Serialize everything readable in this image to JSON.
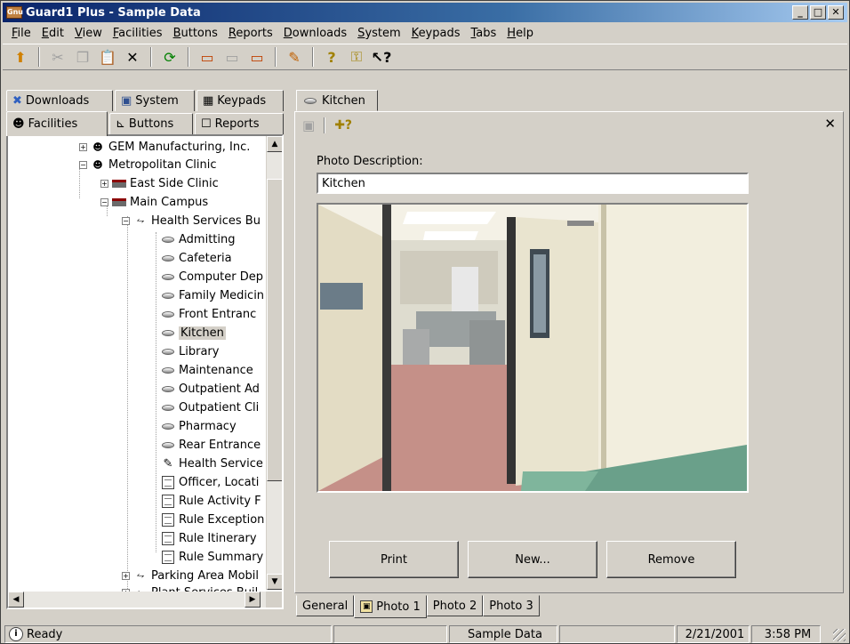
{
  "window": {
    "title": "Guard1 Plus - Sample Data",
    "app_icon_text": "Gnu",
    "minimize": "_",
    "maximize": "□",
    "close": "✕"
  },
  "menu": [
    "File",
    "Edit",
    "View",
    "Facilities",
    "Buttons",
    "Reports",
    "Downloads",
    "System",
    "Keypads",
    "Tabs",
    "Help"
  ],
  "toolbar_icons": [
    "up-folder-icon",
    "cut-icon",
    "copy-icon",
    "paste-icon",
    "delete-icon",
    "refresh-icon",
    "card-icon",
    "card-blank-icon",
    "card-red-icon",
    "paint-icon",
    "help-icon",
    "key-help-icon",
    "whats-this-icon"
  ],
  "left_tabs": {
    "downloads": "Downloads",
    "system": "System",
    "keypads": "Keypads",
    "facilities": "Facilities",
    "buttons": "Buttons",
    "reports": "Reports"
  },
  "tree": [
    {
      "label": "GEM Manufacturing, Inc.",
      "icon": "person-icon"
    },
    {
      "label": "Metropolitan Clinic",
      "icon": "person-icon"
    },
    {
      "label": "East Side Clinic",
      "icon": "building-icon"
    },
    {
      "label": "Main Campus",
      "icon": "building-icon"
    },
    {
      "label": "Health Services Bu",
      "icon": "route-icon"
    },
    {
      "label": "Admitting",
      "icon": "checkpoint-icon"
    },
    {
      "label": "Cafeteria",
      "icon": "checkpoint-icon"
    },
    {
      "label": "Computer Dep",
      "icon": "checkpoint-icon"
    },
    {
      "label": "Family Medicin",
      "icon": "checkpoint-icon"
    },
    {
      "label": "Front Entranc",
      "icon": "checkpoint-icon"
    },
    {
      "label": "Kitchen",
      "icon": "checkpoint-icon"
    },
    {
      "label": "Library",
      "icon": "checkpoint-icon"
    },
    {
      "label": "Maintenance",
      "icon": "checkpoint-icon"
    },
    {
      "label": "Outpatient Ad",
      "icon": "checkpoint-icon"
    },
    {
      "label": "Outpatient Cli",
      "icon": "checkpoint-icon"
    },
    {
      "label": "Pharmacy",
      "icon": "checkpoint-icon"
    },
    {
      "label": "Rear Entrance",
      "icon": "checkpoint-icon"
    },
    {
      "label": "Health Service",
      "icon": "itinerary-icon"
    },
    {
      "label": "Officer, Locati",
      "icon": "report-icon"
    },
    {
      "label": "Rule Activity F",
      "icon": "report-icon"
    },
    {
      "label": "Rule Exception",
      "icon": "report-icon"
    },
    {
      "label": "Rule Itinerary",
      "icon": "report-icon"
    },
    {
      "label": "Rule Summary",
      "icon": "report-icon"
    },
    {
      "label": "Parking Area Mobil",
      "icon": "route-icon"
    },
    {
      "label": "Plant Services Buil",
      "icon": "route-icon"
    }
  ],
  "doc_tab": "Kitchen",
  "photo": {
    "label": "Photo Description:",
    "value": "Kitchen",
    "print": "Print",
    "new": "New...",
    "remove": "Remove"
  },
  "bottom_tabs": [
    "General",
    "Photo 1",
    "Photo 2",
    "Photo 3"
  ],
  "status": {
    "ready": "Ready",
    "database": "Sample Data",
    "date": "2/21/2001",
    "time": "3:58 PM"
  }
}
